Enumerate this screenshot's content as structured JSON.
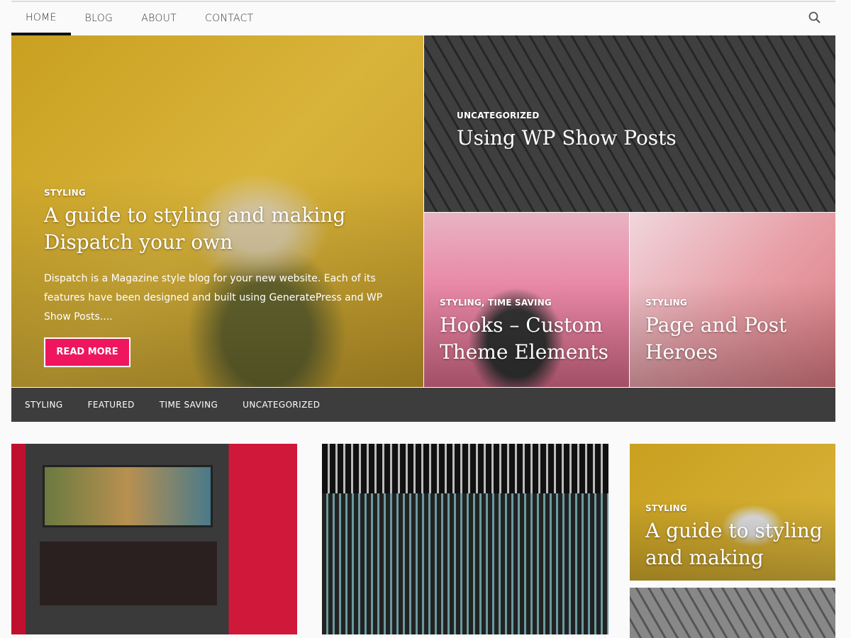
{
  "nav": {
    "items": [
      "HOME",
      "BLOG",
      "ABOUT",
      "CONTACT"
    ],
    "active": "HOME",
    "search_icon": "search-icon"
  },
  "hero": {
    "main": {
      "category": "STYLING",
      "title": "A guide to styling and making Dispatch your own",
      "excerpt": "Dispatch is a Magazine style blog for your new website. Each of its features have been designed and built using GeneratePress and WP Show Posts....",
      "button": "READ MORE"
    },
    "top_right": {
      "category": "UNCATEGORIZED",
      "title": "Using WP Show Posts"
    },
    "bottom_left": {
      "category": "STYLING, TIME SAVING",
      "title": "Hooks – Custom Theme Elements"
    },
    "bottom_right": {
      "category": "STYLING",
      "title": "Page and Post Heroes"
    }
  },
  "category_bar": [
    "STYLING",
    "FEATURED",
    "TIME SAVING",
    "UNCATEGORIZED"
  ],
  "grid": {
    "side_post": {
      "category": "STYLING",
      "title": "A guide to styling and making"
    }
  },
  "colors": {
    "accent": "#f0155f",
    "bar": "#3d3d3d"
  }
}
